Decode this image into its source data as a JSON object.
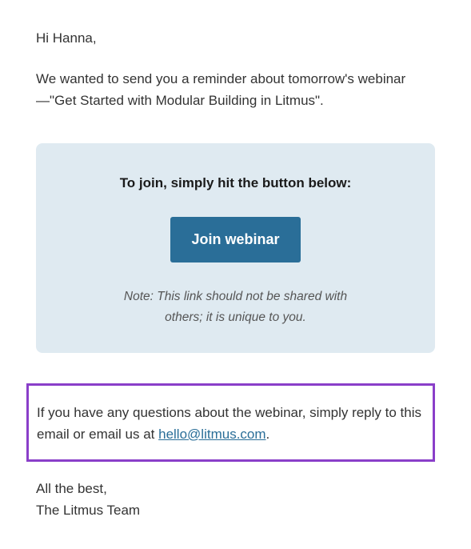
{
  "greeting": "Hi Hanna,",
  "intro": "We wanted to send you a reminder about tomorrow's webinar—\"Get Started with Modular Building in Litmus\".",
  "card": {
    "heading": "To join, simply hit the button below:",
    "button_label": "Join webinar",
    "note": "Note: This link should not be shared with others; it is unique to you."
  },
  "questions": {
    "before_link": "If you have any questions about the webinar, simply reply to this email or email us at ",
    "email": "hello@litmus.com",
    "after_link": "."
  },
  "signoff": {
    "line1": "All the best,",
    "line2": "The Litmus Team"
  },
  "colors": {
    "card_bg": "#dfeaf1",
    "button_bg": "#2a6e98",
    "link": "#2a6e98",
    "highlight_border": "#8a3fc9"
  }
}
